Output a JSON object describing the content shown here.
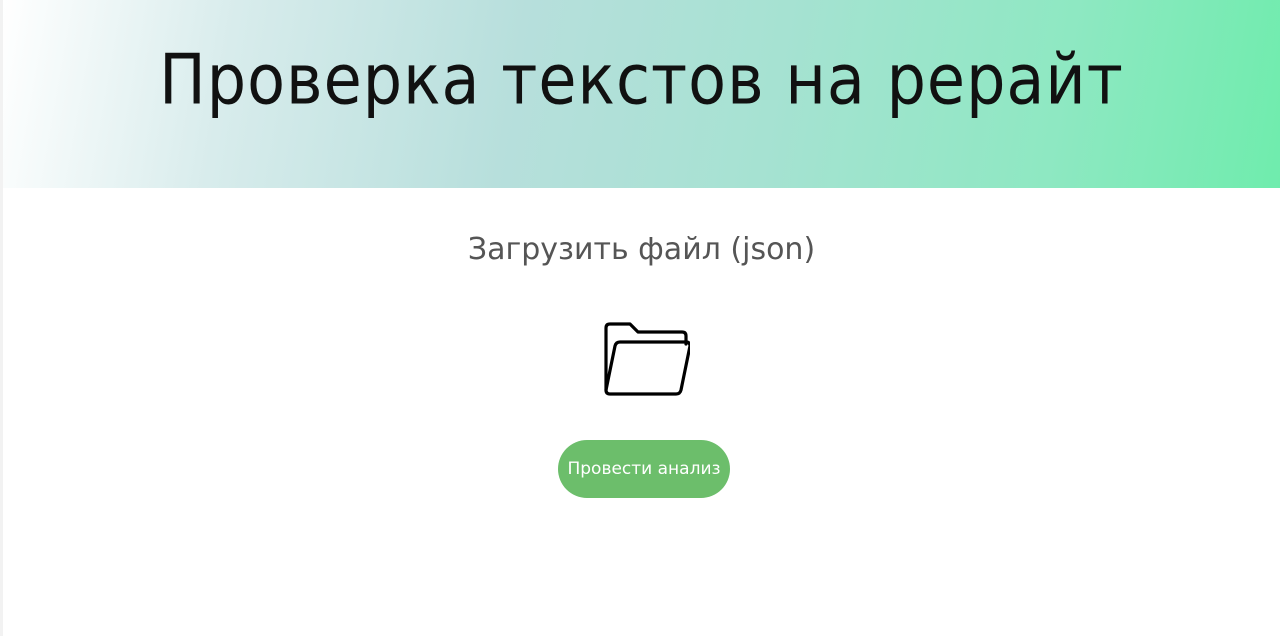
{
  "header": {
    "title": "Проверка текстов на рерайт"
  },
  "upload": {
    "label": "Загрузить файл (json)",
    "icon": "folder-open-icon"
  },
  "actions": {
    "analyze_label": "Провести анализ"
  },
  "colors": {
    "gradient_start": "#ffffff",
    "gradient_end": "#6fecad",
    "button": "#6cbe6b",
    "button_text": "#ffffff",
    "title_text": "#111111",
    "label_text": "#555555"
  }
}
